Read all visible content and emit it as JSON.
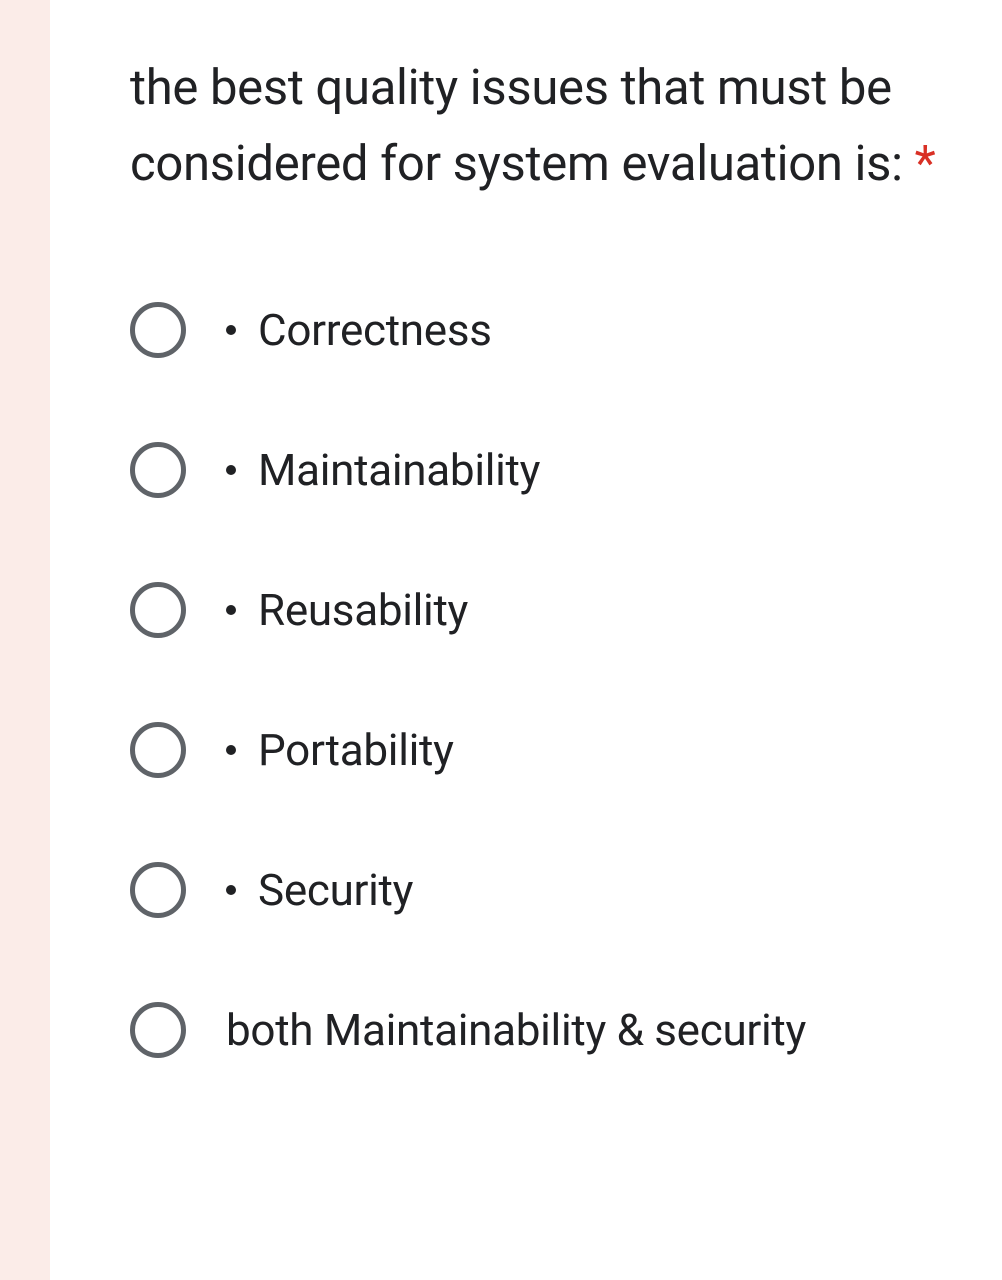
{
  "question": {
    "text": "the best quality issues that must be considered for system evaluation is: ",
    "required_marker": "*"
  },
  "options": [
    {
      "label": "Correctness",
      "has_bullet": true
    },
    {
      "label": "Maintainability",
      "has_bullet": true
    },
    {
      "label": "Reusability",
      "has_bullet": true
    },
    {
      "label": "Portability",
      "has_bullet": true
    },
    {
      "label": "Security",
      "has_bullet": true
    },
    {
      "label": "both Maintainability & security",
      "has_bullet": false
    }
  ]
}
